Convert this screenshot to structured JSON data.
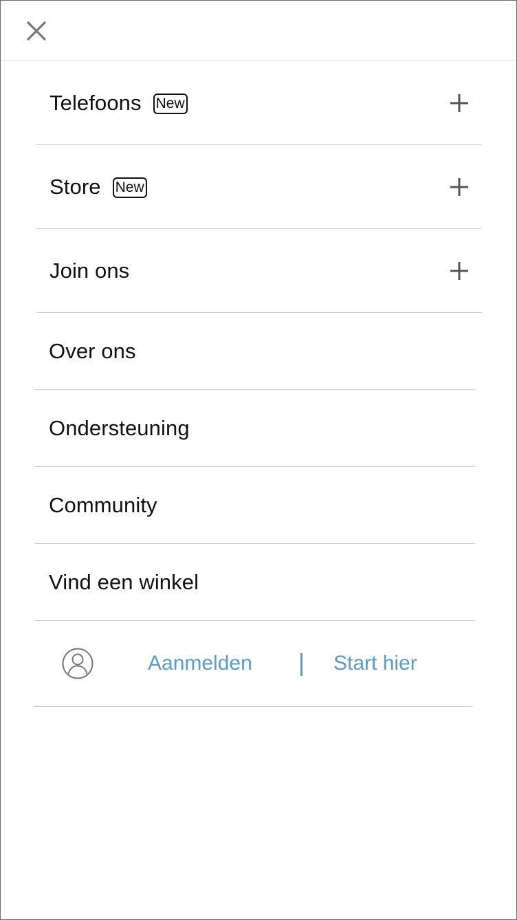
{
  "header": {
    "close_icon": "close-icon"
  },
  "menu": {
    "expandable": [
      {
        "label": "Telefoons",
        "badge": "New",
        "icon": "plus-icon"
      },
      {
        "label": "Store",
        "badge": "New",
        "icon": "plus-icon"
      },
      {
        "label": "Join ons",
        "badge": "",
        "icon": "plus-icon"
      }
    ],
    "links": [
      {
        "label": "Over ons"
      },
      {
        "label": "Ondersteuning"
      },
      {
        "label": "Community"
      },
      {
        "label": "Vind een winkel"
      }
    ]
  },
  "account": {
    "icon": "user-icon",
    "login_label": "Aanmelden",
    "separator": "|",
    "signup_label": "Start hier",
    "link_color": "#5a9cc7"
  }
}
